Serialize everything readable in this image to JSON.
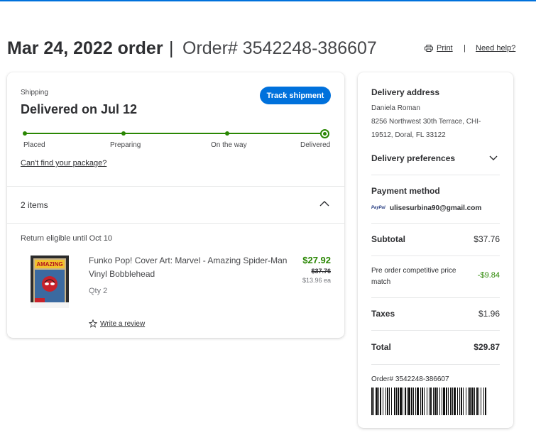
{
  "header": {
    "order_date": "Mar 24, 2022 order",
    "separator": "|",
    "order_number": "Order# 3542248-386607",
    "print_label": "Print",
    "links_separator": "|",
    "help_label": "Need help?"
  },
  "shipment": {
    "label": "Shipping",
    "status": "Delivered on Jul 12",
    "track_button": "Track shipment",
    "steps": [
      "Placed",
      "Preparing",
      "On the way",
      "Delivered"
    ],
    "cant_find": "Can't find your package?",
    "progress": 1.0
  },
  "items": {
    "count_label": "2 items",
    "return_eligible": "Return eligible until Oct 10",
    "product": {
      "name": "Funko Pop! Cover Art: Marvel - Amazing Spider-Man Vinyl Bobblehead",
      "qty": "Qty 2",
      "price": "$27.92",
      "original_price": "$37.76",
      "each_price": "$13.96 ea",
      "review_label": "Write a review",
      "image_text": "AMAZING"
    }
  },
  "delivery": {
    "title": "Delivery address",
    "name": "Daniela Roman",
    "address_line1": "8256 Northwest 30th Terrace, CHI-",
    "address_line2": "19512, Doral, FL 33122",
    "preferences_label": "Delivery preferences"
  },
  "payment": {
    "title": "Payment method",
    "provider_icon": "PayPal",
    "email": "ulisesurbina90@gmail.com"
  },
  "summary": {
    "subtotal_label": "Subtotal",
    "subtotal_value": "$37.76",
    "discount_label": "Pre order competitive price match",
    "discount_value": "-$9.84",
    "taxes_label": "Taxes",
    "taxes_value": "$1.96",
    "total_label": "Total",
    "total_value": "$29.87",
    "order_number": "Order# 3542248-386607"
  },
  "colors": {
    "accent_blue": "#0071dc",
    "success_green": "#2a8703",
    "text_dark": "#2e2f32"
  }
}
